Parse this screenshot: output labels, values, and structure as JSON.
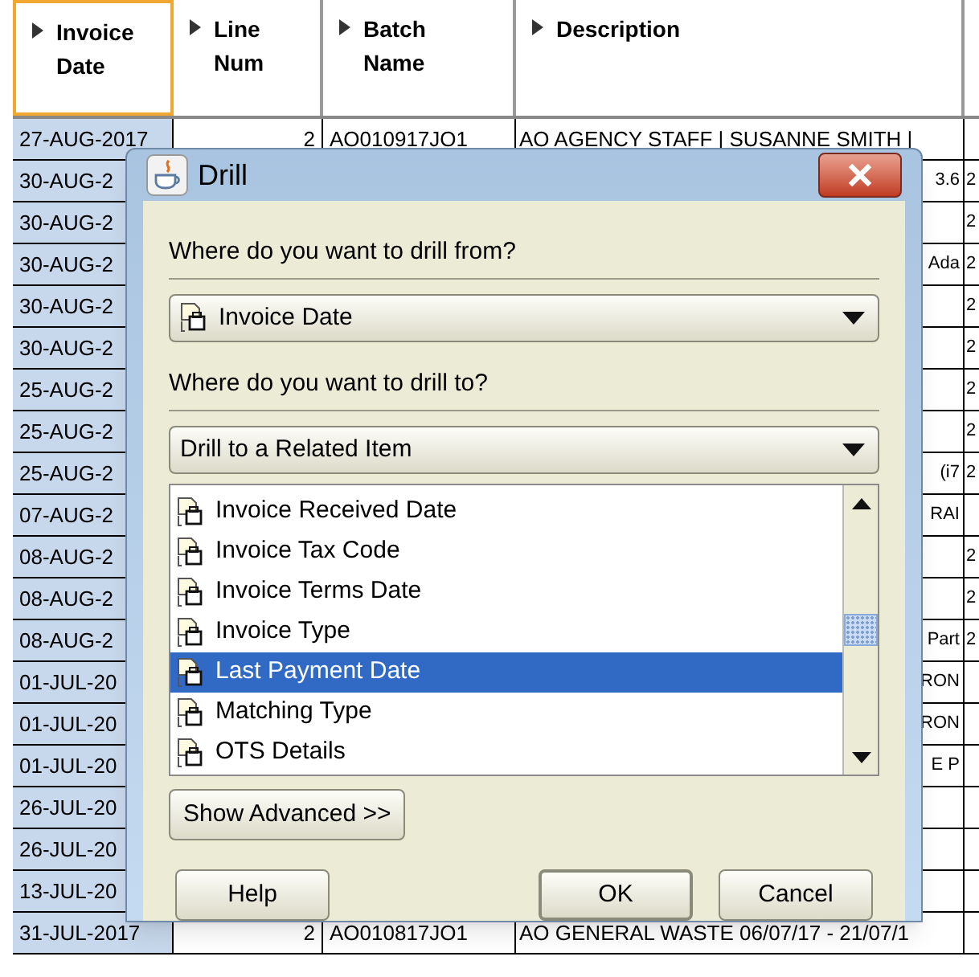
{
  "table": {
    "columns": [
      {
        "label": "Invoice Date",
        "selected": true
      },
      {
        "label": "Line Num",
        "selected": false
      },
      {
        "label": "Batch Name",
        "selected": false
      },
      {
        "label": "Description",
        "selected": false
      }
    ],
    "rows": [
      {
        "date": "27-AUG-2017",
        "line_num": "2",
        "batch_name": "AO010917JO1",
        "description": "AO AGENCY STAFF | SUSANNE SMITH |"
      },
      {
        "date": "30-AUG-2",
        "description": "3.6",
        "column_5": "2"
      },
      {
        "date": "30-AUG-2",
        "column_5": "2"
      },
      {
        "date": "30-AUG-2",
        "description": "Ada",
        "column_5": "2"
      },
      {
        "date": "30-AUG-2",
        "column_5": "2"
      },
      {
        "date": "30-AUG-2",
        "column_5": "2"
      },
      {
        "date": "25-AUG-2",
        "column_5": "2"
      },
      {
        "date": "25-AUG-2",
        "column_5": "2"
      },
      {
        "date": "25-AUG-2",
        "description": "(i7",
        "column_5": "2"
      },
      {
        "date": "07-AUG-2",
        "description": "RAI"
      },
      {
        "date": "08-AUG-2",
        "column_5": "2"
      },
      {
        "date": "08-AUG-2",
        "column_5": "2"
      },
      {
        "date": "08-AUG-2",
        "description": "Part",
        "column_5": "2"
      },
      {
        "date": "01-JUL-20",
        "description": "RON"
      },
      {
        "date": "01-JUL-20",
        "description": "RON"
      },
      {
        "date": "01-JUL-20",
        "description": "E P"
      },
      {
        "date": "26-JUL-20"
      },
      {
        "date": "26-JUL-20"
      },
      {
        "date": "13-JUL-20"
      },
      {
        "date": "31-JUL-2017",
        "line_num": "2",
        "batch_name": "AO010817JO1",
        "description": "AO GENERAL WASTE 06/07/17 - 21/07/1"
      }
    ]
  },
  "dialog": {
    "title": "Drill",
    "from_label": "Where do you want to drill from?",
    "from_value": "Invoice Date",
    "to_label": "Where do you want to drill to?",
    "to_value": "Drill to a Related Item",
    "items": [
      {
        "label": "Invoice Received Date",
        "selected": false
      },
      {
        "label": "Invoice Tax Code",
        "selected": false
      },
      {
        "label": "Invoice Terms Date",
        "selected": false
      },
      {
        "label": "Invoice Type",
        "selected": false
      },
      {
        "label": "Last Payment Date",
        "selected": true
      },
      {
        "label": "Matching Type",
        "selected": false
      },
      {
        "label": "OTS Details",
        "selected": false
      }
    ],
    "show_advanced": "Show Advanced >>",
    "buttons": [
      {
        "label": "Help",
        "default": false
      },
      {
        "label": "OK",
        "default": true
      },
      {
        "label": "Cancel",
        "default": false
      }
    ]
  }
}
